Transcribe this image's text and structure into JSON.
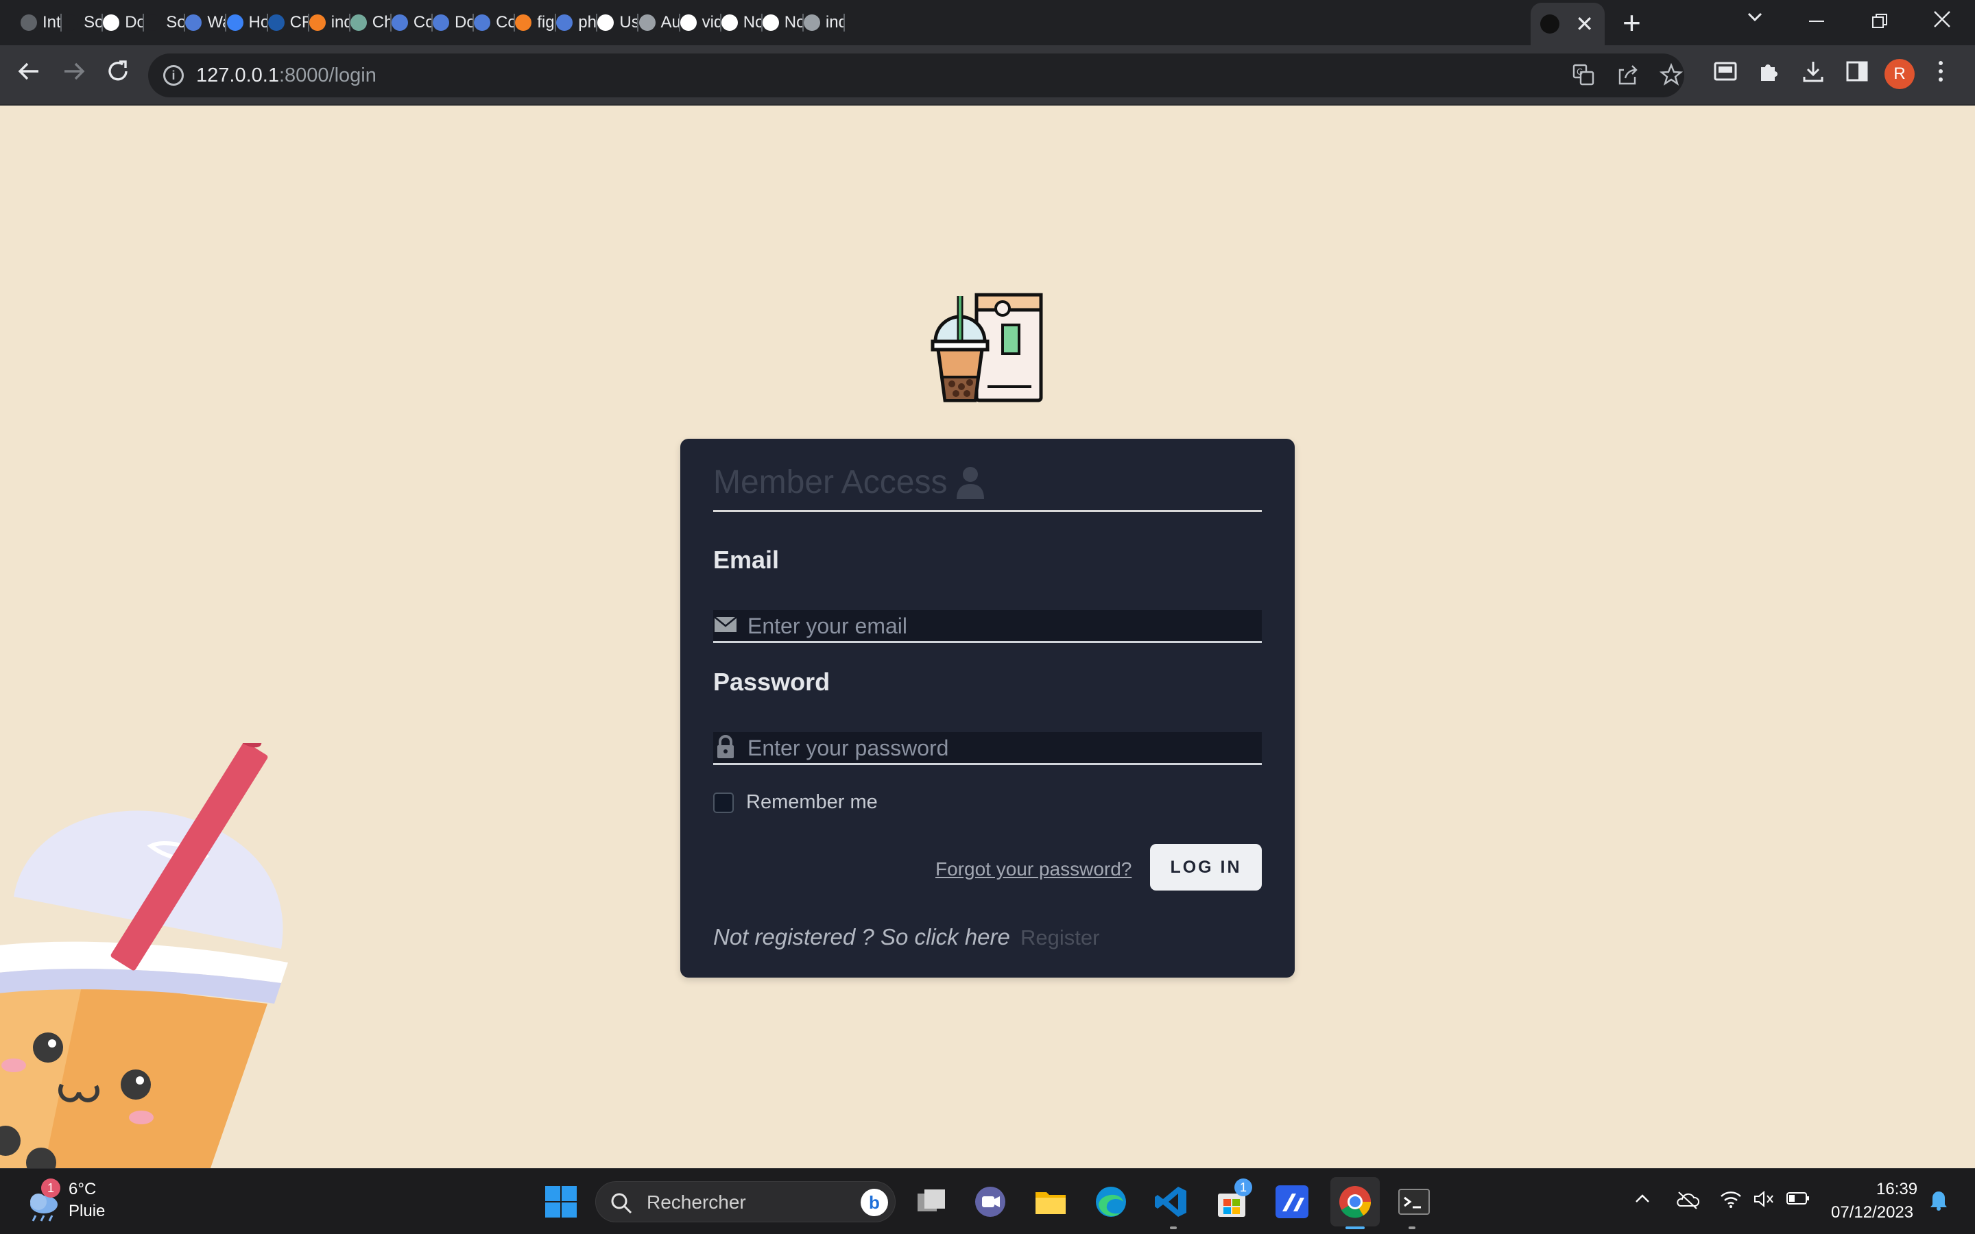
{
  "browser": {
    "tabs": [
      {
        "label": "Inti",
        "color": "#5f6368"
      },
      {
        "label": "Sou",
        "color": "#202124"
      },
      {
        "label": "Do",
        "color": "#ffffff"
      },
      {
        "label": "Sou",
        "color": "#202124"
      },
      {
        "label": "Wa",
        "color": "#4f7bd6"
      },
      {
        "label": "Ho",
        "color": "#3b82f6"
      },
      {
        "label": "CR",
        "color": "#1e5aa8"
      },
      {
        "label": "ind",
        "color": "#f48024"
      },
      {
        "label": "Ch",
        "color": "#74aa9c"
      },
      {
        "label": "Co",
        "color": "#4f7bd6"
      },
      {
        "label": "Do",
        "color": "#4f7bd6"
      },
      {
        "label": "Co",
        "color": "#4f7bd6"
      },
      {
        "label": "fig",
        "color": "#f48024"
      },
      {
        "label": "ph",
        "color": "#4f7bd6"
      },
      {
        "label": "Usi",
        "color": "#ffffff"
      },
      {
        "label": "Au",
        "color": "#9aa0a6"
      },
      {
        "label": "vid",
        "color": "#ffffff"
      },
      {
        "label": "No",
        "color": "#ffffff"
      },
      {
        "label": "No",
        "color": "#ffffff"
      },
      {
        "label": "ind",
        "color": "#9aa0a6"
      }
    ],
    "active_tab_close": "✕",
    "new_tab": "+",
    "url_host": "127.0.0.1",
    "url_rest": ":8000/login"
  },
  "login": {
    "title": "Member Access",
    "email_label": "Email",
    "email_placeholder": "Enter your email",
    "password_label": "Password",
    "password_placeholder": "Enter your password",
    "remember_label": "Remember me",
    "forgot_link": "Forgot your password?",
    "login_button": "LOG IN",
    "not_registered": "Not registered ? So click here",
    "register_link": "Register"
  },
  "taskbar": {
    "weather_temp": "6°C",
    "weather_desc": "Pluie",
    "weather_badge": "1",
    "search_placeholder": "Rechercher",
    "store_badge": "1",
    "time": "16:39",
    "date": "07/12/2023"
  },
  "colors": {
    "page_bg": "#f2e5cf",
    "card_bg": "#1f2433",
    "accent_profile": "#e0542e"
  }
}
